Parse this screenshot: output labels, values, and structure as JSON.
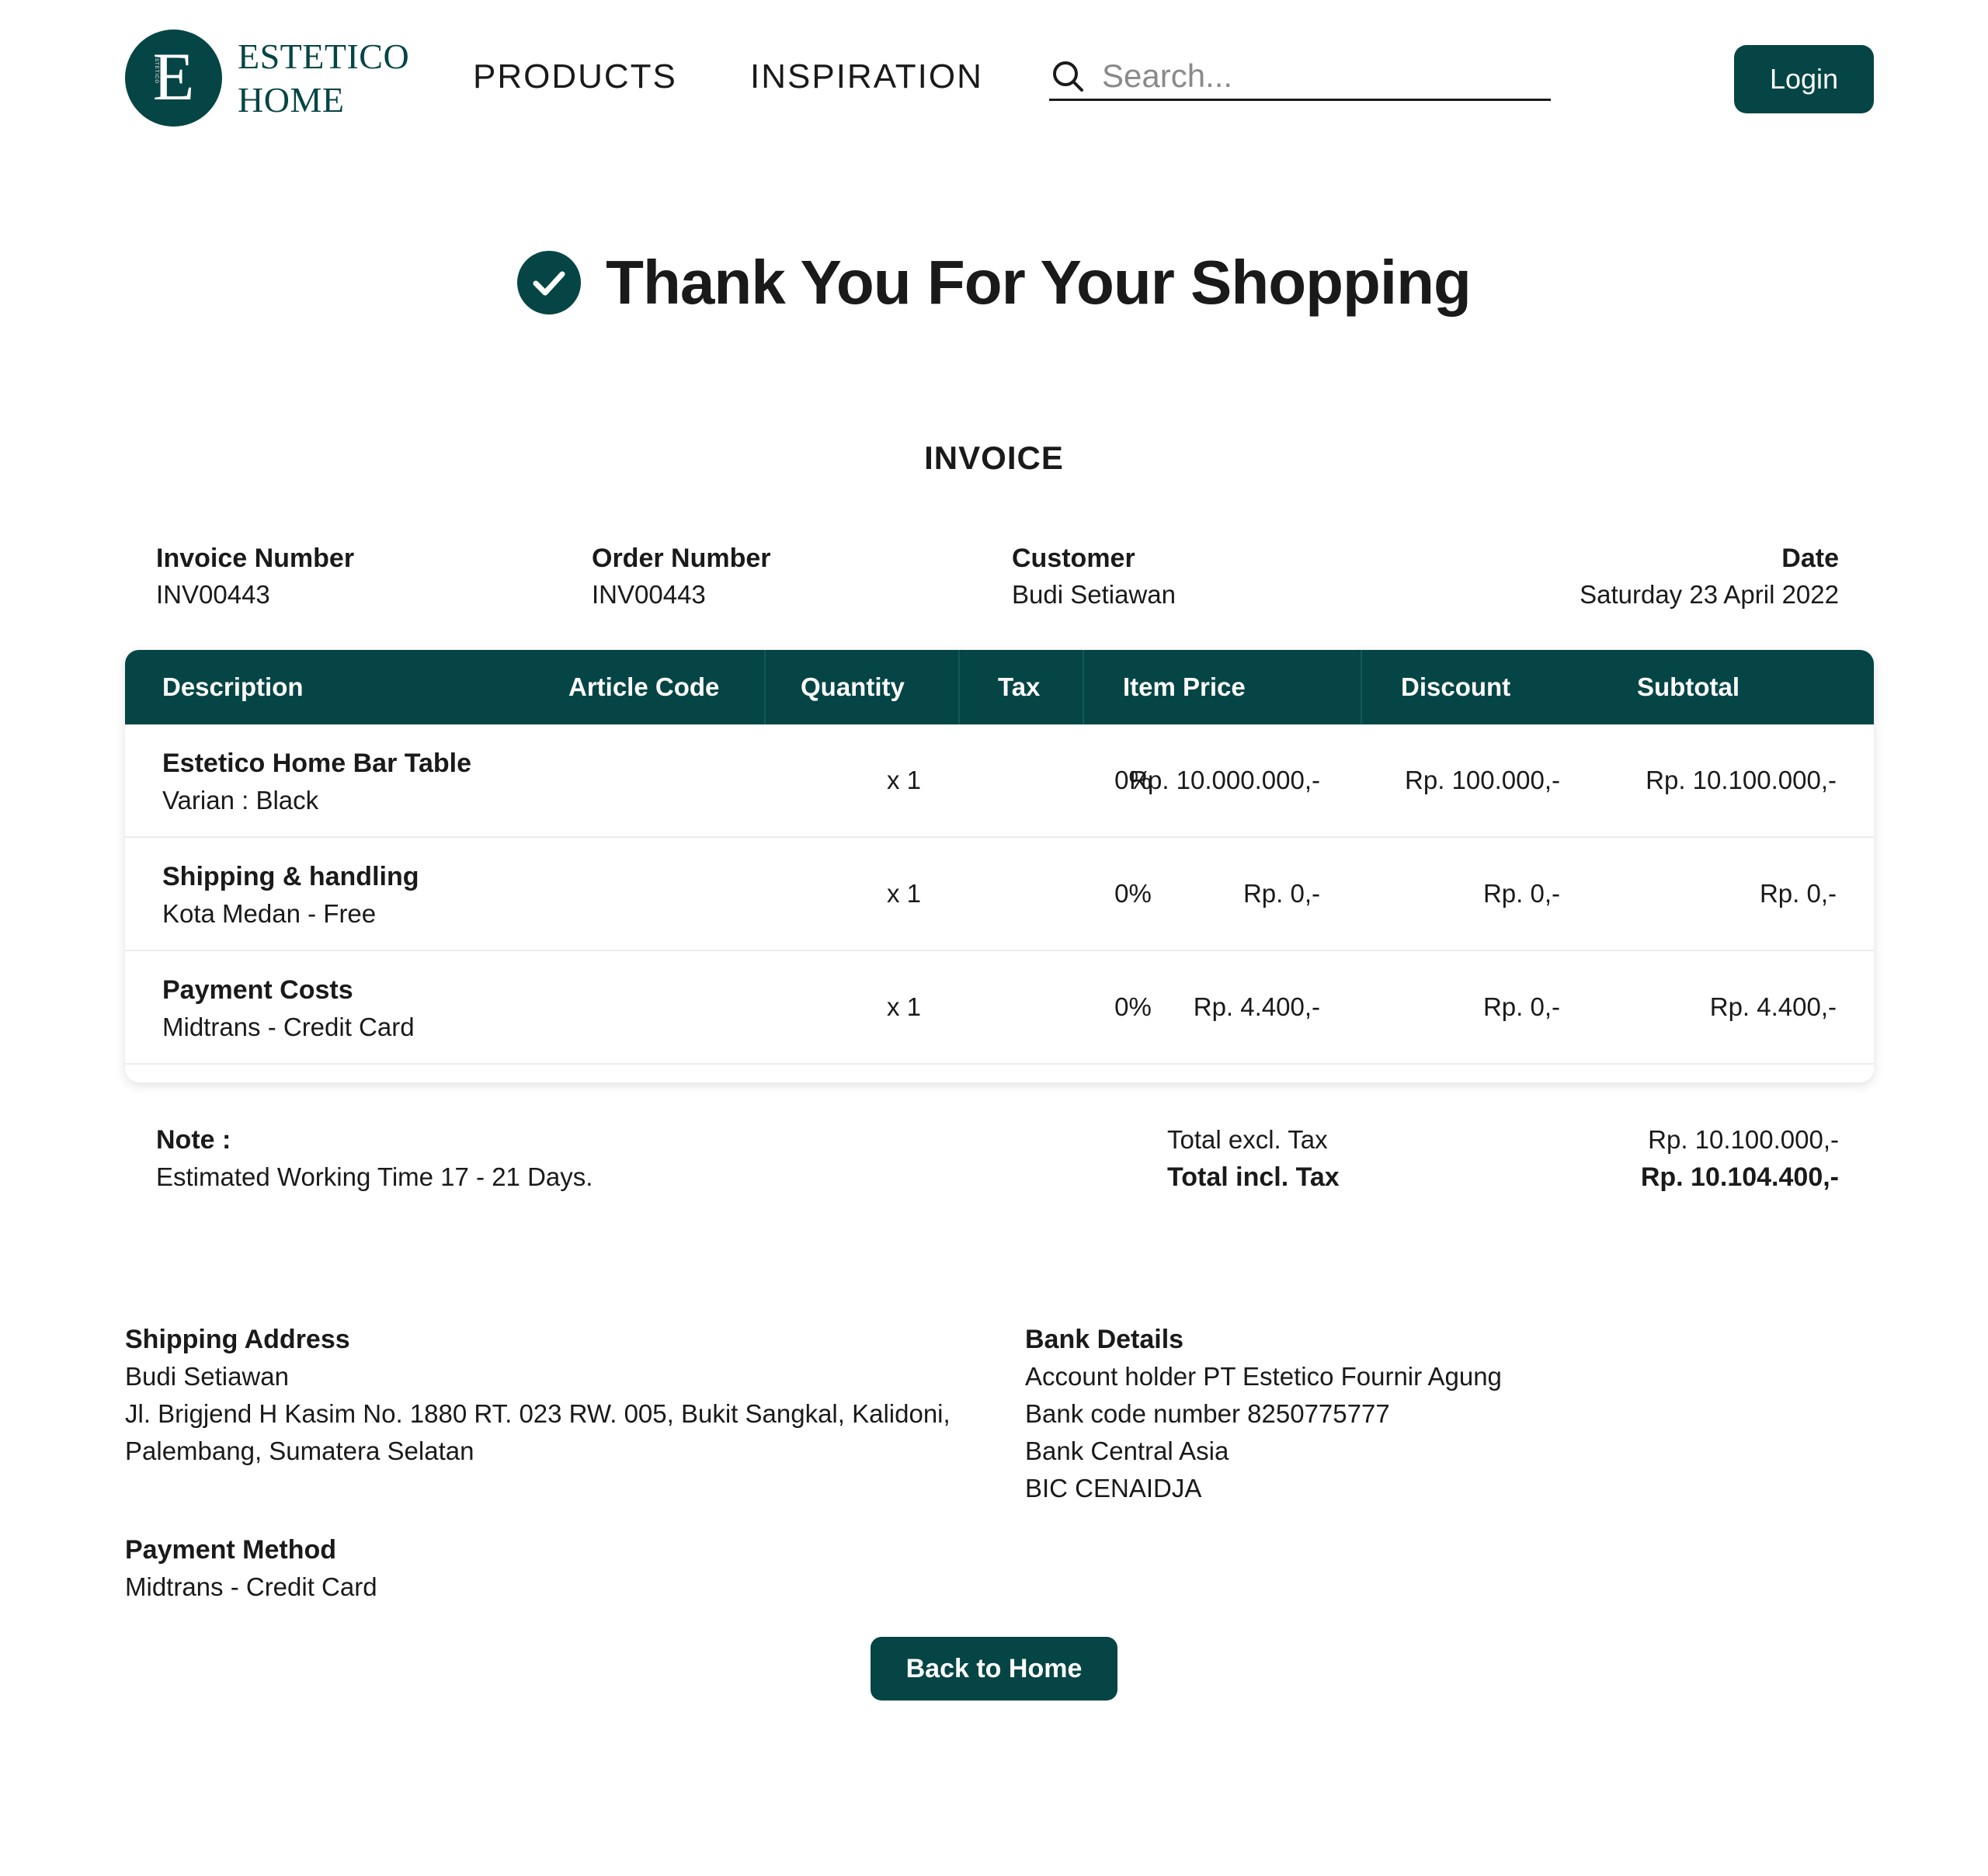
{
  "brand": {
    "letter": "E",
    "side_text": "ESTETICO",
    "line1": "ESTETICO",
    "line2": "HOME",
    "color": "#064545"
  },
  "nav": {
    "products": "PRODUCTS",
    "inspiration": "INSPIRATION"
  },
  "search": {
    "placeholder": "Search...",
    "icon": "search-icon"
  },
  "login_label": "Login",
  "thanks": {
    "title": "Thank You For Your Shopping",
    "icon": "check-circle-icon"
  },
  "invoice": {
    "title": "INVOICE",
    "meta": {
      "invoice_number_label": "Invoice Number",
      "invoice_number": "INV00443",
      "order_number_label": "Order Number",
      "order_number": "INV00443",
      "customer_label": "Customer",
      "customer": "Budi Setiawan",
      "date_label": "Date",
      "date": "Saturday 23 April 2022"
    },
    "columns": [
      "Description",
      "Article Code",
      "Quantity",
      "Tax",
      "Item Price",
      "Discount",
      "Subtotal"
    ],
    "rows": [
      {
        "title": "Estetico Home Bar Table",
        "subtitle": "Varian : Black",
        "article_code": "",
        "quantity": "x 1",
        "tax": "0%",
        "item_price": "Rp. 10.000.000,-",
        "discount": "Rp. 100.000,-",
        "subtotal": "Rp. 10.100.000,-"
      },
      {
        "title": "Shipping & handling",
        "subtitle": "Kota Medan - Free",
        "article_code": "",
        "quantity": "x 1",
        "tax": "0%",
        "item_price": "Rp. 0,-",
        "discount": "Rp. 0,-",
        "subtotal": "Rp. 0,-"
      },
      {
        "title": "Payment Costs",
        "subtitle": "Midtrans - Credit Card",
        "article_code": "",
        "quantity": "x 1",
        "tax": "0%",
        "item_price": "Rp. 4.400,-",
        "discount": "Rp. 0,-",
        "subtotal": "Rp. 4.400,-"
      }
    ],
    "note_label": "Note :",
    "note": "Estimated Working Time 17 - 21 Days.",
    "total_excl_label": "Total excl. Tax",
    "total_excl": "Rp. 10.100.000,-",
    "total_incl_label": "Total incl. Tax",
    "total_incl": "Rp. 10.104.400,-"
  },
  "shipping": {
    "label": "Shipping Address",
    "name": "Budi Setiawan",
    "line1": "Jl. Brigjend H Kasim No. 1880 RT. 023 RW. 005, Bukit Sangkal, Kalidoni,",
    "line2": "Palembang, Sumatera Selatan"
  },
  "bank": {
    "label": "Bank Details",
    "holder": "Account holder PT Estetico Fournir Agung",
    "code": "Bank code number 8250775777",
    "name": "Bank Central Asia",
    "bic": "BIC CENAIDJA"
  },
  "payment": {
    "label": "Payment Method",
    "method": "Midtrans - Credit Card"
  },
  "back_label": "Back to Home"
}
